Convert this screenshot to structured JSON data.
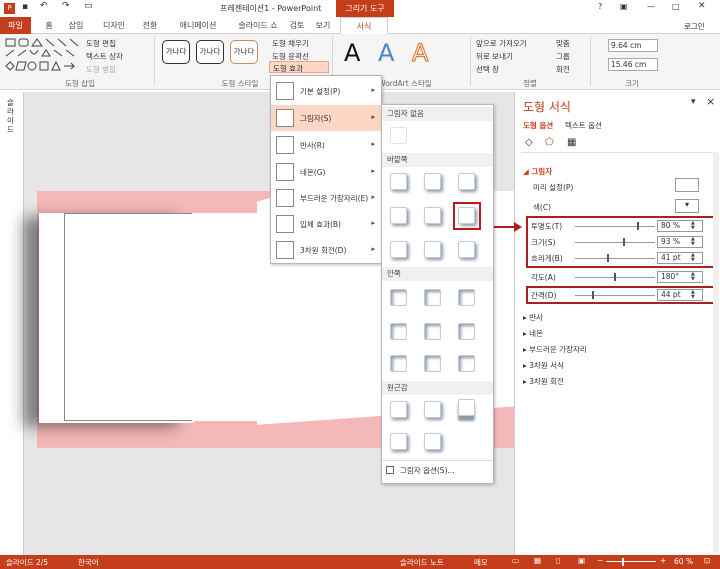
{
  "window": {
    "title": "프레젠테이션1 - PowerPoint",
    "context_tab": "그리기 도구",
    "help": "?",
    "signin": "로그인"
  },
  "tabs": [
    "파일",
    "홈",
    "삽입",
    "디자인",
    "전환",
    "애니메이션",
    "슬라이드 쇼",
    "검토",
    "보기",
    "서식"
  ],
  "ribbon": {
    "groups": {
      "insert_shapes": "도형 삽입",
      "shape_styles": "도형 스타일",
      "wordart_styles": "WordArt 스타일",
      "arrange": "정렬",
      "size": "크기"
    },
    "edit_shape": "도형 편집",
    "text_box": "텍스트 상자",
    "merge_shapes": "도형 병합",
    "style_samples": [
      "가나다",
      "가나다",
      "가나다"
    ],
    "shape_fill": "도형 채우기",
    "shape_outline": "도형 윤곽선",
    "shape_effects": "도형 효과",
    "wordart_letters": [
      "A",
      "A",
      "A"
    ],
    "bring_forward": "앞으로 가져오기",
    "send_backward": "뒤로 보내기",
    "selection_pane": "선택 창",
    "align": "맞춤",
    "group": "그룹",
    "rotate": "회전",
    "height": "9.64 cm",
    "width": "15.46 cm"
  },
  "effects_menu": {
    "items": [
      {
        "label": "기본 설정(P)"
      },
      {
        "label": "그림자(S)"
      },
      {
        "label": "반사(R)"
      },
      {
        "label": "네온(G)"
      },
      {
        "label": "부드러운 가장자리(E)"
      },
      {
        "label": "입체 효과(B)"
      },
      {
        "label": "3차원 회전(D)"
      }
    ],
    "arrow": "▸"
  },
  "shadow_gallery": {
    "none": "그림자 없음",
    "outer": "바깥쪽",
    "inner": "안쪽",
    "perspective": "원근감",
    "options": "그림자 옵션(S)..."
  },
  "panel": {
    "title": "도형 서식",
    "close": "×",
    "dropdown": "▾",
    "tab_shape": "도형 옵션",
    "tab_text": "텍스트 옵션",
    "shadow_section": "그림자",
    "presets": "미리 설정(P)",
    "color": "색(C)",
    "props": [
      {
        "label": "투명도(T)",
        "value": "80 %",
        "level": 0.8
      },
      {
        "label": "크기(S)",
        "value": "93 %",
        "level": 0.62
      },
      {
        "label": "흐리게(B)",
        "value": "41 pt",
        "level": 0.41
      },
      {
        "label": "각도(A)",
        "value": "180°",
        "level": 0.5
      },
      {
        "label": "간격(D)",
        "value": "44 pt",
        "level": 0.22
      }
    ],
    "collapsed": [
      "반사",
      "네온",
      "부드러운 가장자리",
      "3차원 서식",
      "3차원 회전"
    ]
  },
  "left_pane_label": "슬라이드",
  "status": {
    "slide": "슬라이드 2/5",
    "lang": "한국어",
    "notes": "슬라이드 노트",
    "comments": "메모",
    "zoom": "60 %"
  },
  "colors": {
    "accent": "#c43e1c",
    "pink": "#f5b8b9",
    "highlight": "#b01e1e"
  }
}
